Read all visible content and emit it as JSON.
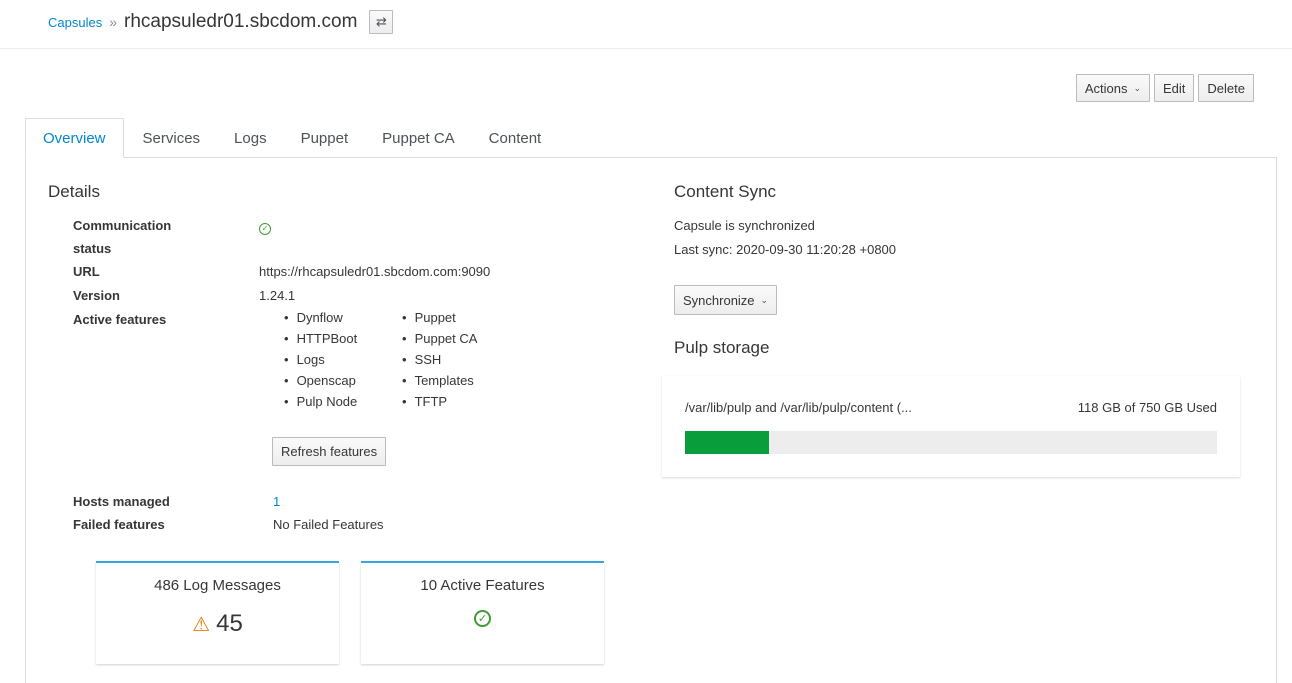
{
  "breadcrumb": {
    "parent": "Capsules",
    "separator": "»",
    "current": "rhcapsuledr01.sbcdom.com",
    "switch_icon": "⇄"
  },
  "toolbar": {
    "actions": "Actions",
    "edit": "Edit",
    "delete": "Delete",
    "caret": "⌄"
  },
  "tabs": [
    "Overview",
    "Services",
    "Logs",
    "Puppet",
    "Puppet CA",
    "Content"
  ],
  "details": {
    "heading": "Details",
    "communication_label_1": "Communication",
    "communication_label_2": "status",
    "communication_icon": "✓",
    "url_label": "URL",
    "url_value": "https://rhcapsuledr01.sbcdom.com:9090",
    "version_label": "Version",
    "version_value": "1.24.1",
    "features_label": "Active features",
    "features": [
      "Dynflow",
      "Puppet",
      "HTTPBoot",
      "Puppet CA",
      "Logs",
      "SSH",
      "Openscap",
      "Templates",
      "Pulp Node",
      "TFTP"
    ],
    "refresh_button": "Refresh features",
    "hosts_label": "Hosts managed",
    "hosts_value": "1",
    "failed_label": "Failed features",
    "failed_value": "No Failed Features"
  },
  "cards": {
    "log_title": "486 Log Messages",
    "log_icon": "⚠",
    "log_count": "45",
    "features_title": "10 Active Features",
    "features_icon": "✓"
  },
  "content_sync": {
    "heading": "Content Sync",
    "status": "Capsule is synchronized",
    "last_sync": "Last sync: 2020-09-30 11:20:28 +0800",
    "synchronize_button": "Synchronize"
  },
  "pulp": {
    "heading": "Pulp storage",
    "path": "/var/lib/pulp and /var/lib/pulp/content (...",
    "used": "118 GB of 750 GB Used",
    "used_fraction": 0.157
  },
  "colors": {
    "accent": "#0088ce",
    "ok": "#3f9c35",
    "warning": "#ec7a08",
    "bar": "#0a9d3b"
  }
}
